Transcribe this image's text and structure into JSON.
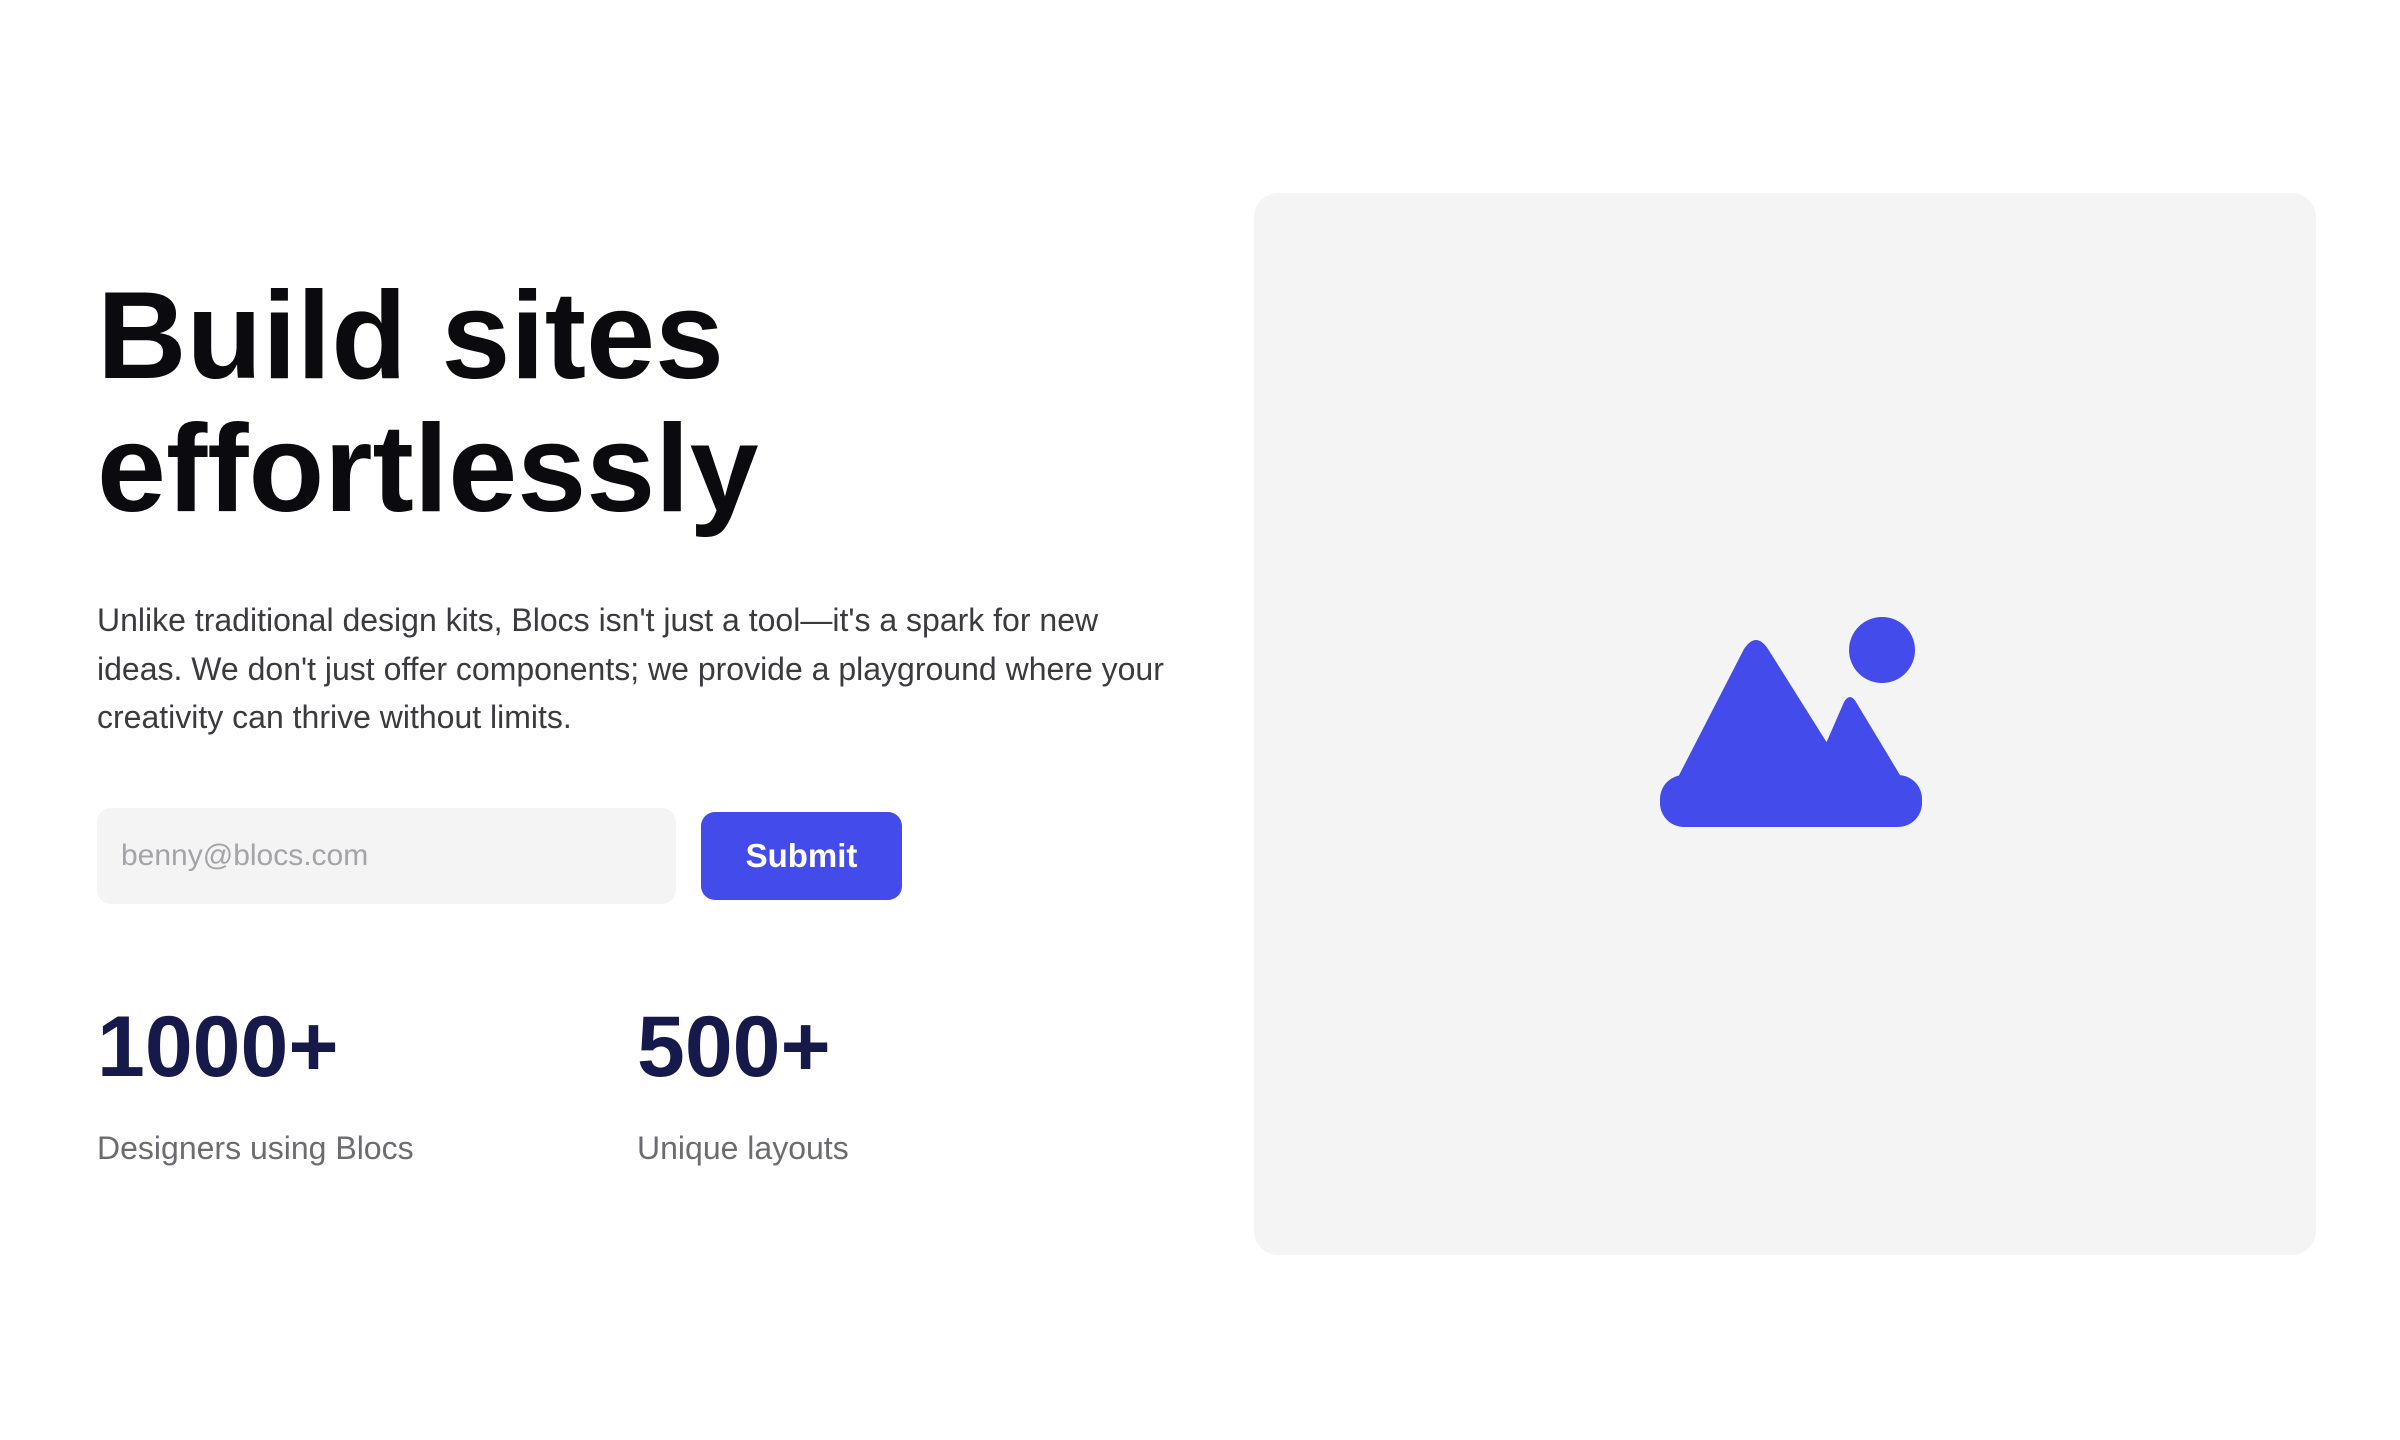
{
  "hero": {
    "headline_line1": "Build sites",
    "headline_line2": "effortlessly",
    "lead": "Unlike traditional design kits, Blocs isn't just a tool—it's a spark for new ideas. We don't just offer components; we provide a playground where your creativity can thrive without limits.",
    "email_placeholder": "benny@blocs.com",
    "submit_label": "Submit",
    "stats": [
      {
        "value": "1000+",
        "label": "Designers using Blocs"
      },
      {
        "value": "500+",
        "label": "Unique layouts"
      }
    ]
  },
  "media": {
    "icon": "image-placeholder-icon"
  },
  "colors": {
    "accent": "#434bea",
    "stat_value": "#161a4b",
    "panel_bg": "#f4f4f4",
    "input_bg": "#f4f4f4"
  }
}
